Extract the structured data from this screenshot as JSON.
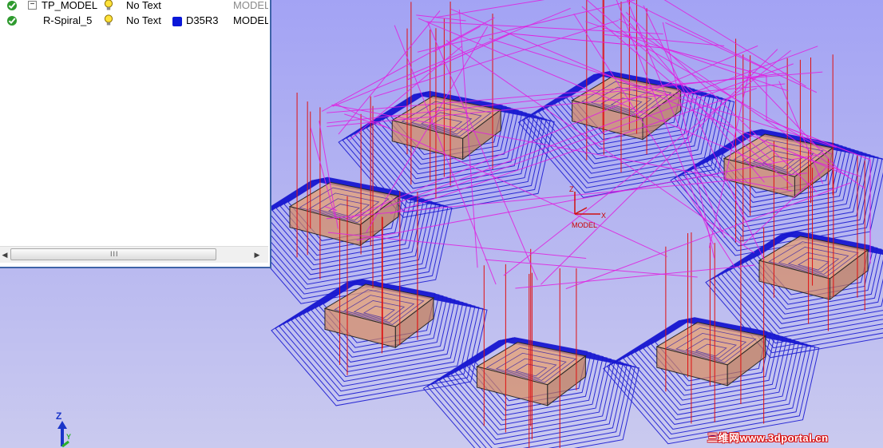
{
  "tree": {
    "rows": [
      {
        "name": "TP_MODEL",
        "text": "No Text",
        "tool": "",
        "ref": "MODEL",
        "expander": "−"
      },
      {
        "name": "R-Spiral_5",
        "text": "No Text",
        "tool": "D35R3",
        "ref": "MODEL",
        "expander": ""
      }
    ],
    "scroll_grip": "III",
    "arrow_left": "◀",
    "arrow_right": "▶"
  },
  "viewport": {
    "origin_x_label": "X",
    "origin_z_label": "Z",
    "origin_name": "MODEL",
    "triad_z_label": "Z",
    "triad_y_label": "Y",
    "colors": {
      "background_top": "#a3a3f4",
      "toolpath_blue": "#1a1ad0",
      "lead_magenta": "#e020e0",
      "plunge_red": "#e01010",
      "model_fill": "#e8a070",
      "model_edge": "#2a2a2a"
    }
  },
  "watermark": "三维网www.3dportal.cn"
}
